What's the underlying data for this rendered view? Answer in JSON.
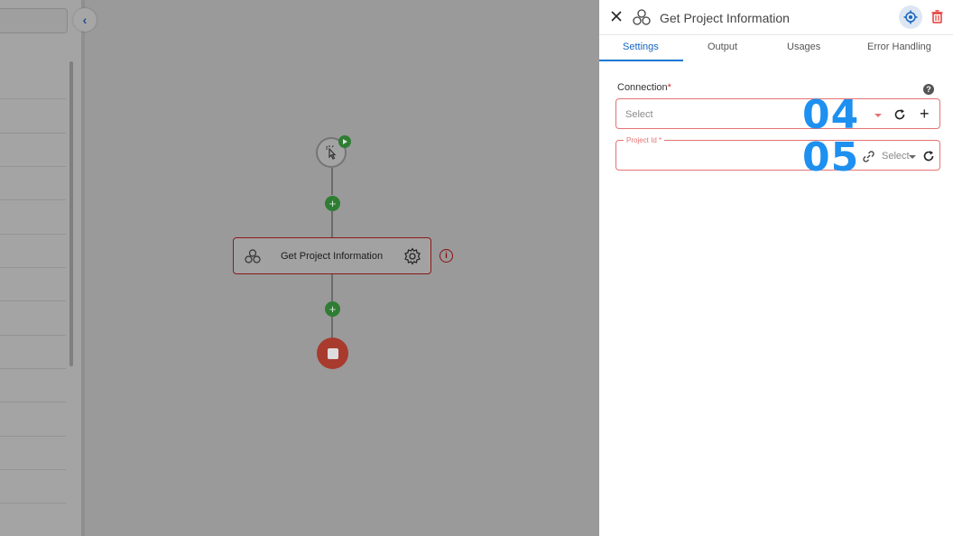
{
  "panel": {
    "title": "Get Project Information",
    "tabs": [
      {
        "label": "Settings",
        "active": true
      },
      {
        "label": "Output",
        "active": false
      },
      {
        "label": "Usages",
        "active": false
      },
      {
        "label": "Error Handling",
        "active": false
      }
    ],
    "connection": {
      "label": "Connection",
      "required_mark": "*",
      "placeholder": "Select",
      "help_icon": "?"
    },
    "project_id": {
      "label": "Project Id *",
      "select_label": "Select"
    }
  },
  "canvas": {
    "step_label": "Get Project Information",
    "add_icon": "+",
    "error_icon": "i"
  },
  "annotations": {
    "connection_marker": "04",
    "project_marker": "05"
  },
  "colors": {
    "accent": "#1976d2",
    "error": "#e57373",
    "success": "#2e7d32",
    "stop": "#a83b2e",
    "annotation": "#1e90f0"
  }
}
